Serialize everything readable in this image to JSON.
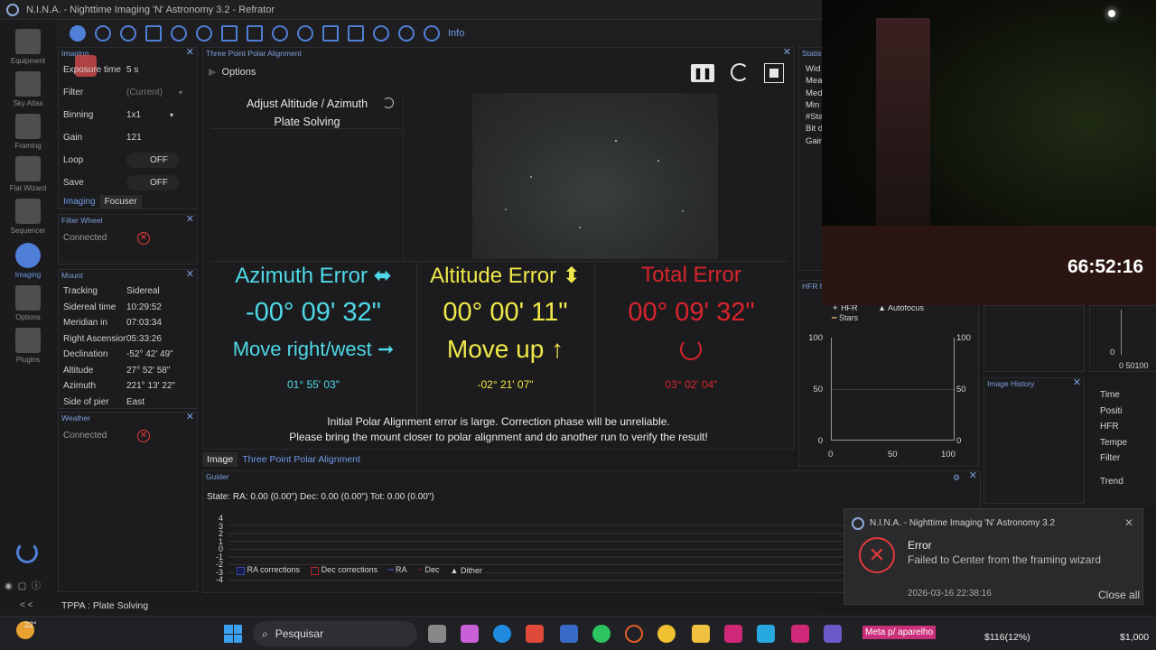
{
  "window": {
    "title": "N.I.N.A. - Nighttime Imaging 'N' Astronomy 3.2  -  Refrator"
  },
  "sidebar": {
    "items": [
      {
        "label": "Equipment",
        "active": false
      },
      {
        "label": "Sky Atlas",
        "active": false
      },
      {
        "label": "Framing",
        "active": false
      },
      {
        "label": "Flat Wizard",
        "active": false
      },
      {
        "label": "Sequencer",
        "active": false
      },
      {
        "label": "Imaging",
        "active": true
      },
      {
        "label": "Options",
        "active": false
      },
      {
        "label": "Plugins",
        "active": false
      }
    ],
    "collapse": "< <"
  },
  "toolbar": {
    "info": "Info"
  },
  "imaging": {
    "title": "Imaging",
    "rows": [
      {
        "k": "Exposure time",
        "v": "5  s"
      },
      {
        "k": "Filter",
        "v": "(Current)"
      },
      {
        "k": "Binning",
        "v": "1x1"
      },
      {
        "k": "Gain",
        "v": "121"
      },
      {
        "k": "Loop",
        "v": "OFF"
      },
      {
        "k": "Save",
        "v": "OFF"
      }
    ],
    "tabs": [
      "Imaging",
      "Focuser"
    ]
  },
  "filter_wheel": {
    "title": "Filter Wheel",
    "status": "Connected"
  },
  "mount": {
    "title": "Mount",
    "rows": [
      {
        "k": "Tracking",
        "v": "Sidereal"
      },
      {
        "k": "Sidereal time",
        "v": "10:29:52"
      },
      {
        "k": "Meridian in",
        "v": "07:03:34"
      },
      {
        "k": "Right Ascension",
        "v": "05:33:26"
      },
      {
        "k": "Declination",
        "v": "-52° 42' 49\""
      },
      {
        "k": "Altitude",
        "v": "27° 52' 58\""
      },
      {
        "k": "Azimuth",
        "v": "221° 13' 22\""
      },
      {
        "k": "Side of pier",
        "v": "East"
      }
    ]
  },
  "weather": {
    "title": "Weather",
    "status": "Connected"
  },
  "tppa": {
    "title": "Three Point Polar Alignment",
    "options": "Options",
    "step1": "Adjust Altitude / Azimuth",
    "step2": "Plate Solving",
    "az_title": "Azimuth Error ⬌",
    "az_value": "-00° 09' 32\"",
    "az_move": "Move right/west ➞",
    "az_pos": "01° 55' 03\"",
    "alt_title": "Altitude Error ⬍",
    "alt_value": "00° 00' 11\"",
    "alt_move": "Move up ↑",
    "alt_pos": "-02° 21' 07\"",
    "tot_title": "Total Error",
    "tot_value": "00° 09' 32\"",
    "tot_pos": "03° 02' 04\"",
    "msg1": "Initial Polar Alignment error is large. Correction phase will be unreliable.",
    "msg2": "Please bring the mount closer to polar alignment and do another run to verify the result!",
    "tabs": [
      "Image",
      "Three Point Polar Alignment"
    ]
  },
  "statistics": {
    "title": "Statist",
    "rows": [
      "Wid",
      "Mea",
      "Med",
      "Min",
      "#Sta",
      "Bit d",
      "Gain"
    ]
  },
  "hfr": {
    "title": "HFR h",
    "legend": [
      "HFR",
      "Autofocus",
      "Stars"
    ],
    "yl": [
      "100",
      "50",
      "0"
    ],
    "yr": [
      "100",
      "50",
      "0"
    ],
    "x": [
      "0",
      "50",
      "100"
    ]
  },
  "right_mini": {
    "y": "0",
    "x": "0 50100",
    "rows": [
      "Time",
      "Positi",
      "HFR",
      "Tempe",
      "Filter",
      "Trend"
    ]
  },
  "image_history": {
    "title": "Image History"
  },
  "guider": {
    "title": "Guider",
    "state": "State:  RA: 0.00 (0.00\")  Dec: 0.00 (0.00\")  Tot: 0.00 (0.00\")",
    "yticks": [
      "4",
      "3",
      "2",
      "1",
      "0",
      "-1",
      "-2",
      "-3",
      "-4"
    ],
    "legend": [
      "RA corrections",
      "Dec corrections",
      "RA",
      "Dec",
      "Dither"
    ]
  },
  "status": {
    "text": "TPPA :  Plate Solving"
  },
  "timer": "66:52:16",
  "toast": {
    "app": "N.I.N.A. - Nighttime Imaging 'N' Astronomy 3.2",
    "title": "Error",
    "body": "Failed to Center from the framing wizard",
    "time": "2026-03-16 22:38:16",
    "close_all": "Close all"
  },
  "taskbar": {
    "temp": "22°",
    "search": "Pesquisar",
    "meta": "Meta p/ aparelho",
    "ticker1": "$116(12%)",
    "ticker2": "$1,000"
  }
}
